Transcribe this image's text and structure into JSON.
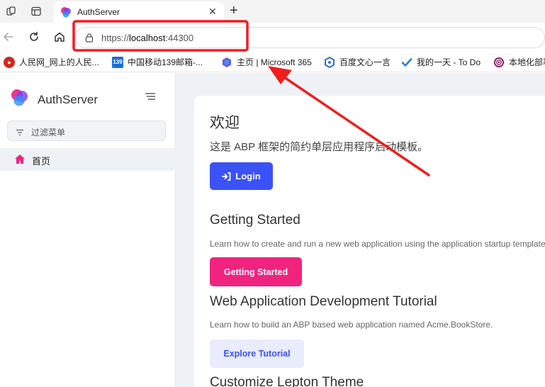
{
  "browser": {
    "tab": {
      "title": "AuthServer"
    },
    "address": {
      "scheme": "https://",
      "host": "localhost",
      "port": ":44300"
    },
    "bookmarks": [
      {
        "label": "人民网_网上的人民...",
        "icon": "people-daily-icon",
        "color": "#d9261c"
      },
      {
        "label": "中国移动139邮箱-...",
        "icon": "139-mail-icon",
        "color": "#1b6fd6"
      },
      {
        "label": "主页 | Microsoft 365",
        "icon": "microsoft-365-icon",
        "color": "#7b4fe0"
      },
      {
        "label": "百度文心一言",
        "icon": "wenxin-icon",
        "color": "#2f6cf6"
      },
      {
        "label": "我的一天 - To Do",
        "icon": "todo-icon",
        "color": "#2a7de1"
      },
      {
        "label": "本地化部署",
        "icon": "spiral-icon",
        "color": "#8a1a6b"
      }
    ]
  },
  "sidebar": {
    "brand": "AuthServer",
    "filter_placeholder": "过滤菜单",
    "items": [
      {
        "label": "首页",
        "icon": "home-icon"
      }
    ]
  },
  "main": {
    "welcome_title": "欢迎",
    "welcome_desc": "这是 ABP 框架的简约单层应用程序启动模板。",
    "login_label": "Login",
    "sections": [
      {
        "title": "Getting Started",
        "desc": "Learn how to create and run a new web application using the application startup template.",
        "button": "Getting Started"
      },
      {
        "title": "Web Application Development Tutorial",
        "desc": "Learn how to build an ABP based web application named Acme.BookStore.",
        "button": "Explore Tutorial"
      },
      {
        "title": "Customize Lepton Theme"
      }
    ]
  },
  "colors": {
    "primary": "#3a52f7",
    "pink": "#f0247f",
    "annotation_red": "#f21d1d"
  }
}
